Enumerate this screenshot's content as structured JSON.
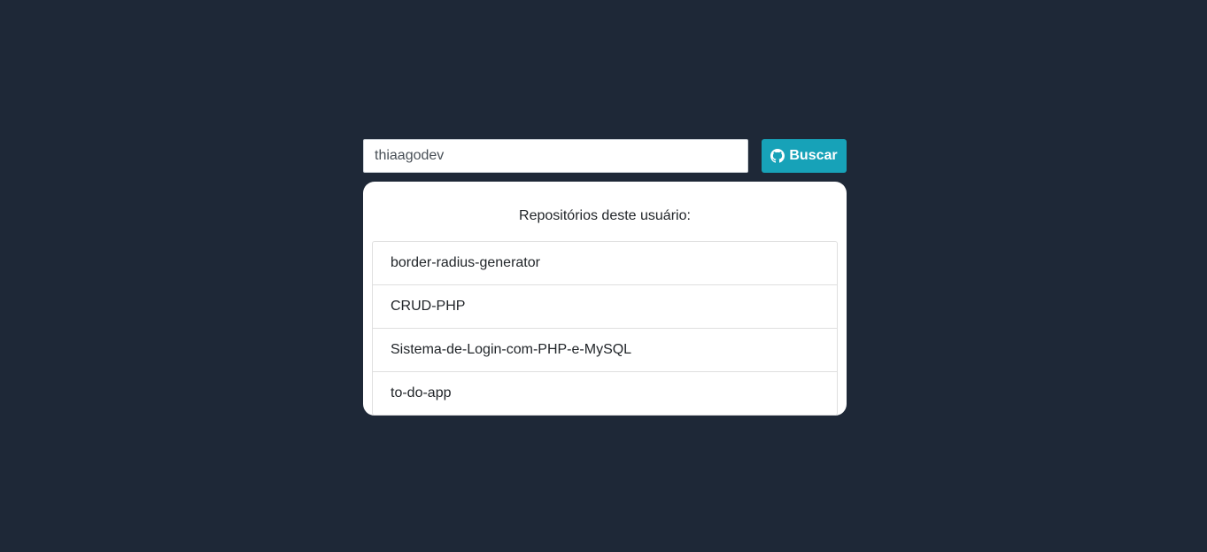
{
  "search": {
    "value": "thiaagodev",
    "button_label": "Buscar",
    "button_icon": "github-icon"
  },
  "repositories": {
    "title": "Repositórios deste usuário:",
    "items": [
      {
        "name": "border-radius-generator"
      },
      {
        "name": "CRUD-PHP"
      },
      {
        "name": "Sistema-de-Login-com-PHP-e-MySQL"
      },
      {
        "name": "to-do-app"
      }
    ]
  },
  "colors": {
    "background": "#1e2837",
    "button": "#17a2b8",
    "card": "#ffffff"
  }
}
